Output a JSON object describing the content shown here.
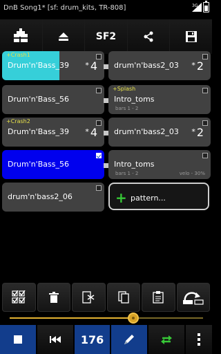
{
  "status_bar": {
    "title": "DnB Song1* [sf: drum_kits, TR-808]",
    "network": "3G"
  },
  "toolbar": {
    "add_track_icon": "add-track-icon",
    "eject_icon": "eject-icon",
    "sf2_label": "SF2",
    "share_icon": "share-icon",
    "save_icon": "save-icon"
  },
  "patterns": [
    {
      "left": {
        "tag": "+Crash1",
        "name": "Drum'n'Bass_39",
        "repeat": "4",
        "progress_fraction": 0.54,
        "checked": false
      },
      "right": {
        "name": "drum'n'bass2_03",
        "repeat": "2",
        "checked": false
      }
    },
    {
      "left": {
        "name": "Drum'n'Bass_56",
        "checked": false
      },
      "right": {
        "tag": "+Splash",
        "name": "Intro_toms",
        "sub": "bars 1 - 2",
        "checked": false
      }
    },
    {
      "left": {
        "tag": "+Crash2",
        "name": "Drum'n'Bass_39",
        "repeat": "4",
        "checked": false
      },
      "right": {
        "name": "drum'n'bass2_03",
        "repeat": "2",
        "checked": false
      }
    },
    {
      "left": {
        "name": "Drum'n'Bass_56",
        "checked": true,
        "selected": true
      },
      "right": {
        "name": "Intro_toms",
        "sub": "bars 1 - 2",
        "velo": "velo - 30%",
        "checked": false
      }
    },
    {
      "left": {
        "name": "drum'n'bass2_06",
        "checked": false
      },
      "right": {
        "name": "pattern...",
        "add_button": true
      }
    }
  ],
  "star": "*",
  "plus": "+",
  "edit_bar": {
    "icons": [
      "select-all-icon",
      "delete-icon",
      "cut-icon",
      "copy-icon",
      "paste-icon",
      "loop-repeat-icon"
    ]
  },
  "slider": {
    "value_fraction": 0.64
  },
  "transport": {
    "tempo": "176",
    "stop_icon": "stop-icon",
    "rewind_icon": "skip-back-icon",
    "pencil_icon": "pencil-icon",
    "loop_icon": "loop-icon",
    "menu_icon": "overflow-menu-icon"
  },
  "colors": {
    "accent_blue": "#0000ee",
    "progress_cyan": "#36cfd9",
    "tag_yellow": "#e6e04a",
    "add_green": "#37c837",
    "slider_gold": "#e4b332"
  }
}
